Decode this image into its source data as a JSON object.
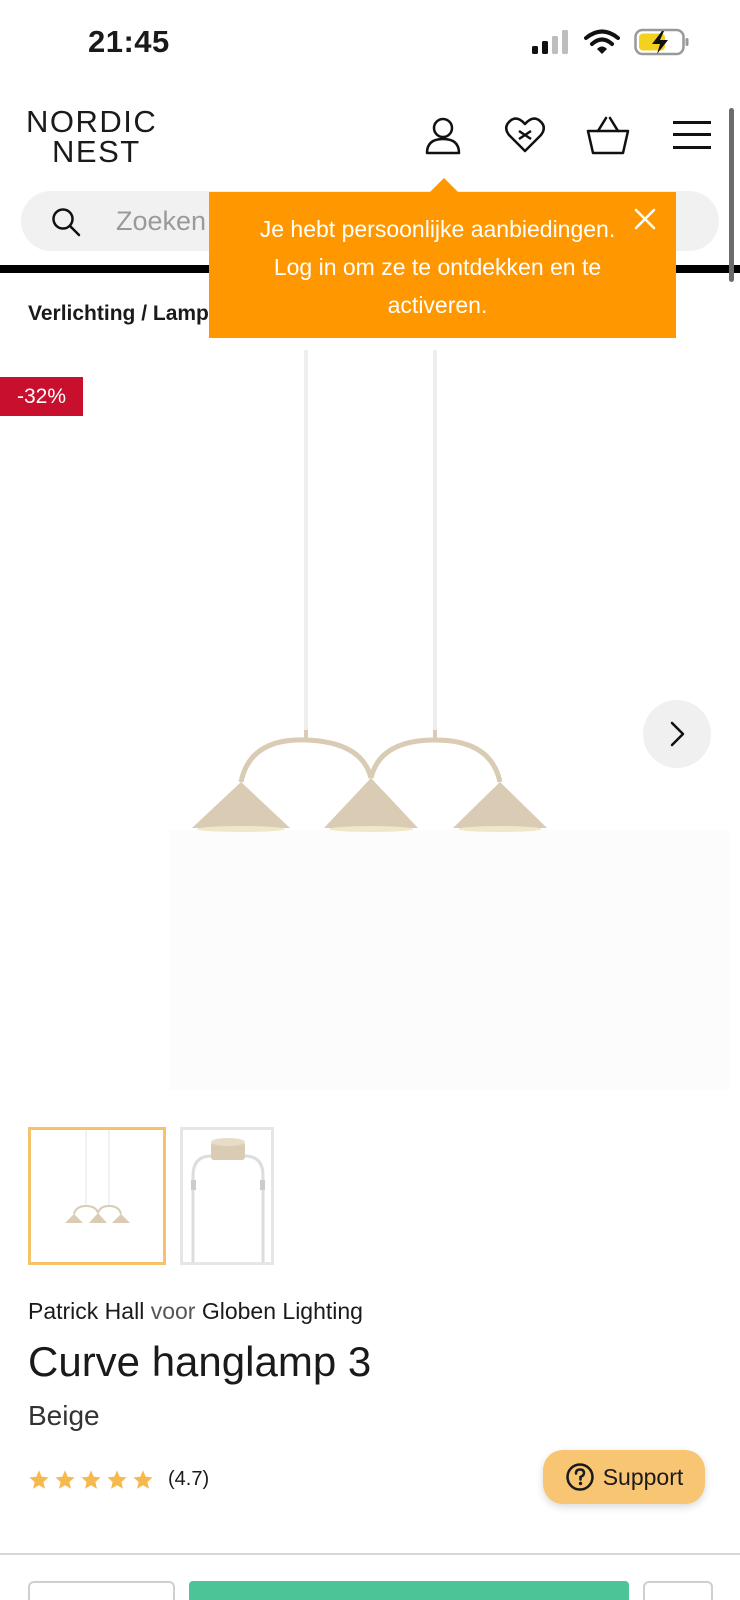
{
  "status_bar": {
    "time": "21:45",
    "icons": [
      "signal-icon",
      "wifi-icon",
      "battery-charging-icon"
    ]
  },
  "header": {
    "logo_line1": "NORDIC",
    "logo_line2": "NEST",
    "icons": [
      "account-icon",
      "wishlist-icon",
      "basket-icon",
      "menu-icon"
    ]
  },
  "search": {
    "placeholder": "Zoeken"
  },
  "breadcrumb": "Verlichting / Lamp",
  "tooltip": {
    "text": "Je hebt persoonlijke aanbiedingen. Log in om ze te ontdekken en te activeren."
  },
  "product": {
    "discount": "-32%",
    "designer": "Patrick Hall",
    "connector": "voor",
    "brand": "Globen Lighting",
    "title": "Curve hanglamp 3",
    "variant": "Beige",
    "rating": "(4.7)",
    "stars": 4.7,
    "thumbnails": 2
  },
  "support": {
    "label": "Support"
  },
  "colors": {
    "tooltip": "#ff9800",
    "discount": "#c8102e",
    "support": "#f8c573",
    "star": "#f6b94e",
    "add_to_cart": "#4cc497",
    "lamp": "#d9cbb4"
  }
}
